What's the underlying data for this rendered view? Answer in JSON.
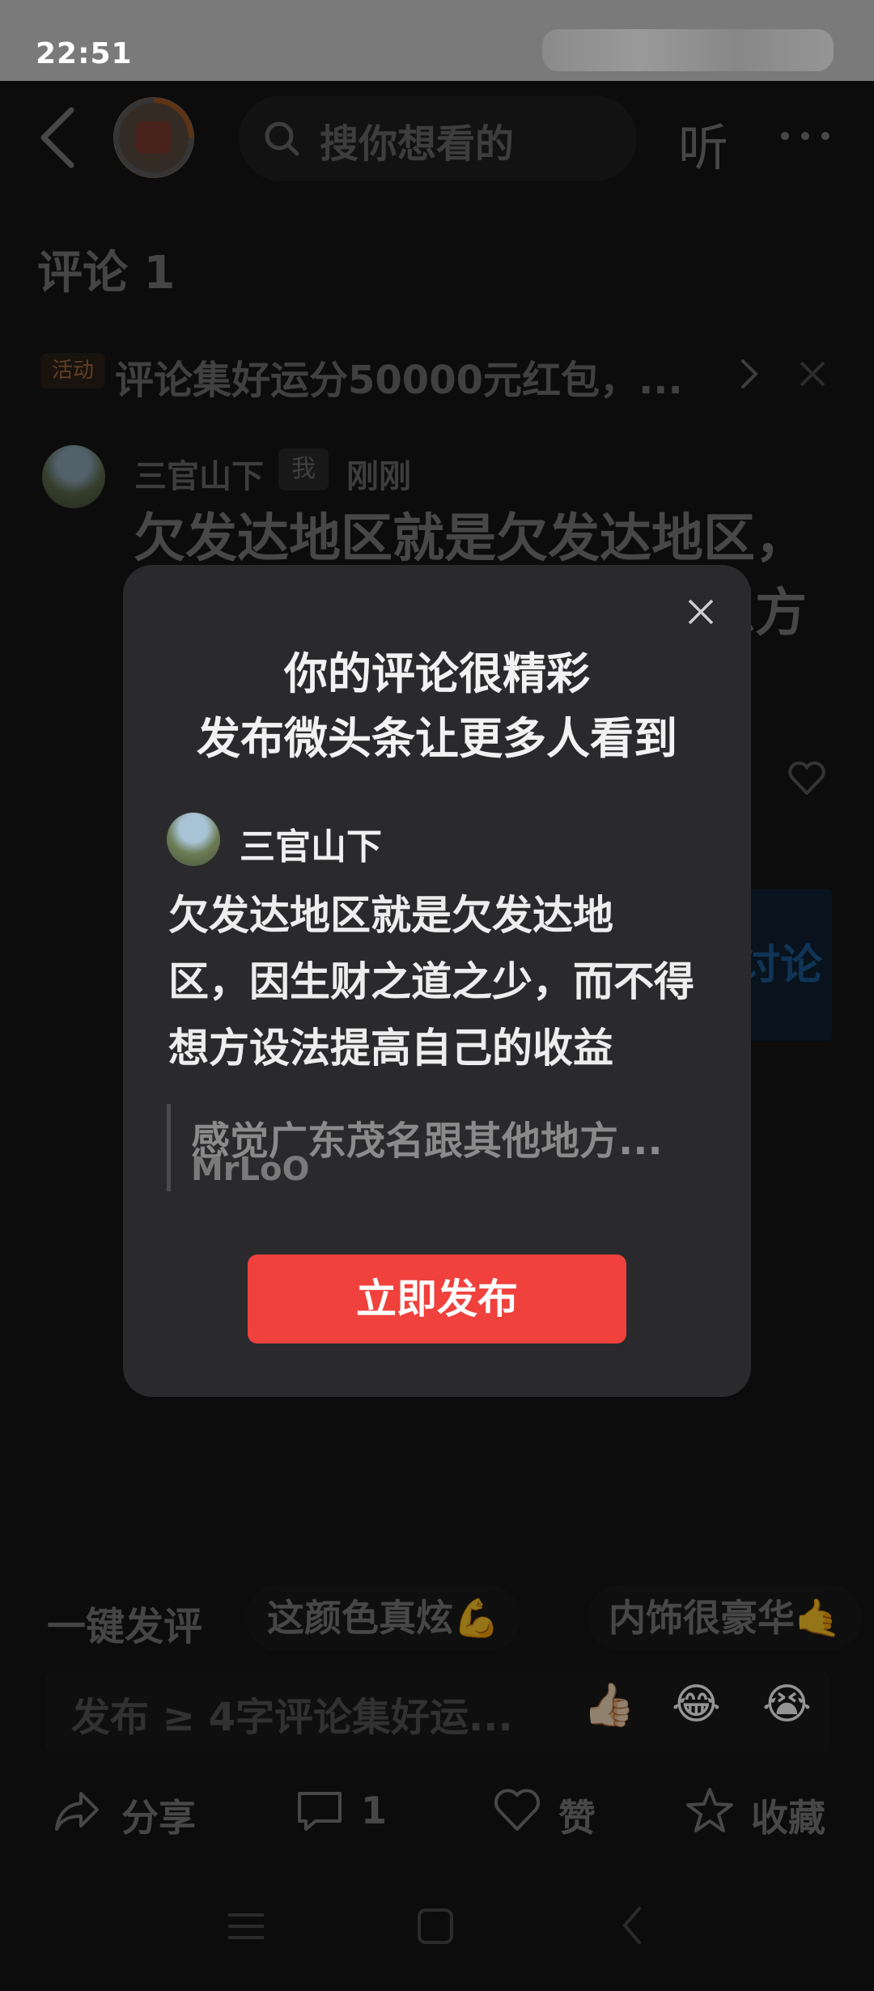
{
  "status_bar": {
    "time": "22:51"
  },
  "header": {
    "search_placeholder": "搜你想看的",
    "listen_label": "听"
  },
  "comments": {
    "title": "评论 1",
    "activity_badge": "活动",
    "activity_text": "评论集好运分50000元红包，...",
    "item": {
      "author": "三官山下",
      "me_tag": "我",
      "time": "刚刚",
      "body": "欠发达地区就是欠发达地区，因生财之道之少，而不得想方设法提高自己的收益",
      "discuss_label": "讨论"
    }
  },
  "quick_comments": {
    "label": "一键发评",
    "chips": [
      "这颜色真炫💪",
      "内饰很豪华🤙"
    ]
  },
  "input": {
    "placeholder": "发布 ≥ 4字评论集好运...",
    "emojis": [
      "👍🏻",
      "😂",
      "😭"
    ]
  },
  "bottom_bar": {
    "share": "分享",
    "comment_count": "1",
    "like": "赞",
    "favorite": "收藏"
  },
  "dialog": {
    "title_line1": "你的评论很精彩",
    "title_line2": "发布微头条让更多人看到",
    "author": "三官山下",
    "body_line1": "欠发达地区就是欠发达地",
    "body_line2": "区，因生财之道之少，而不得",
    "body_line3": "想方设法提高自己的收益",
    "quote_text": "感觉广东茂名跟其他地方...",
    "quote_author": "MrLoO",
    "publish_button": "立即发布"
  },
  "colors": {
    "accent_red": "#f0413d",
    "dialog_bg": "#2a2a2c",
    "link_blue": "#1d5a93"
  }
}
